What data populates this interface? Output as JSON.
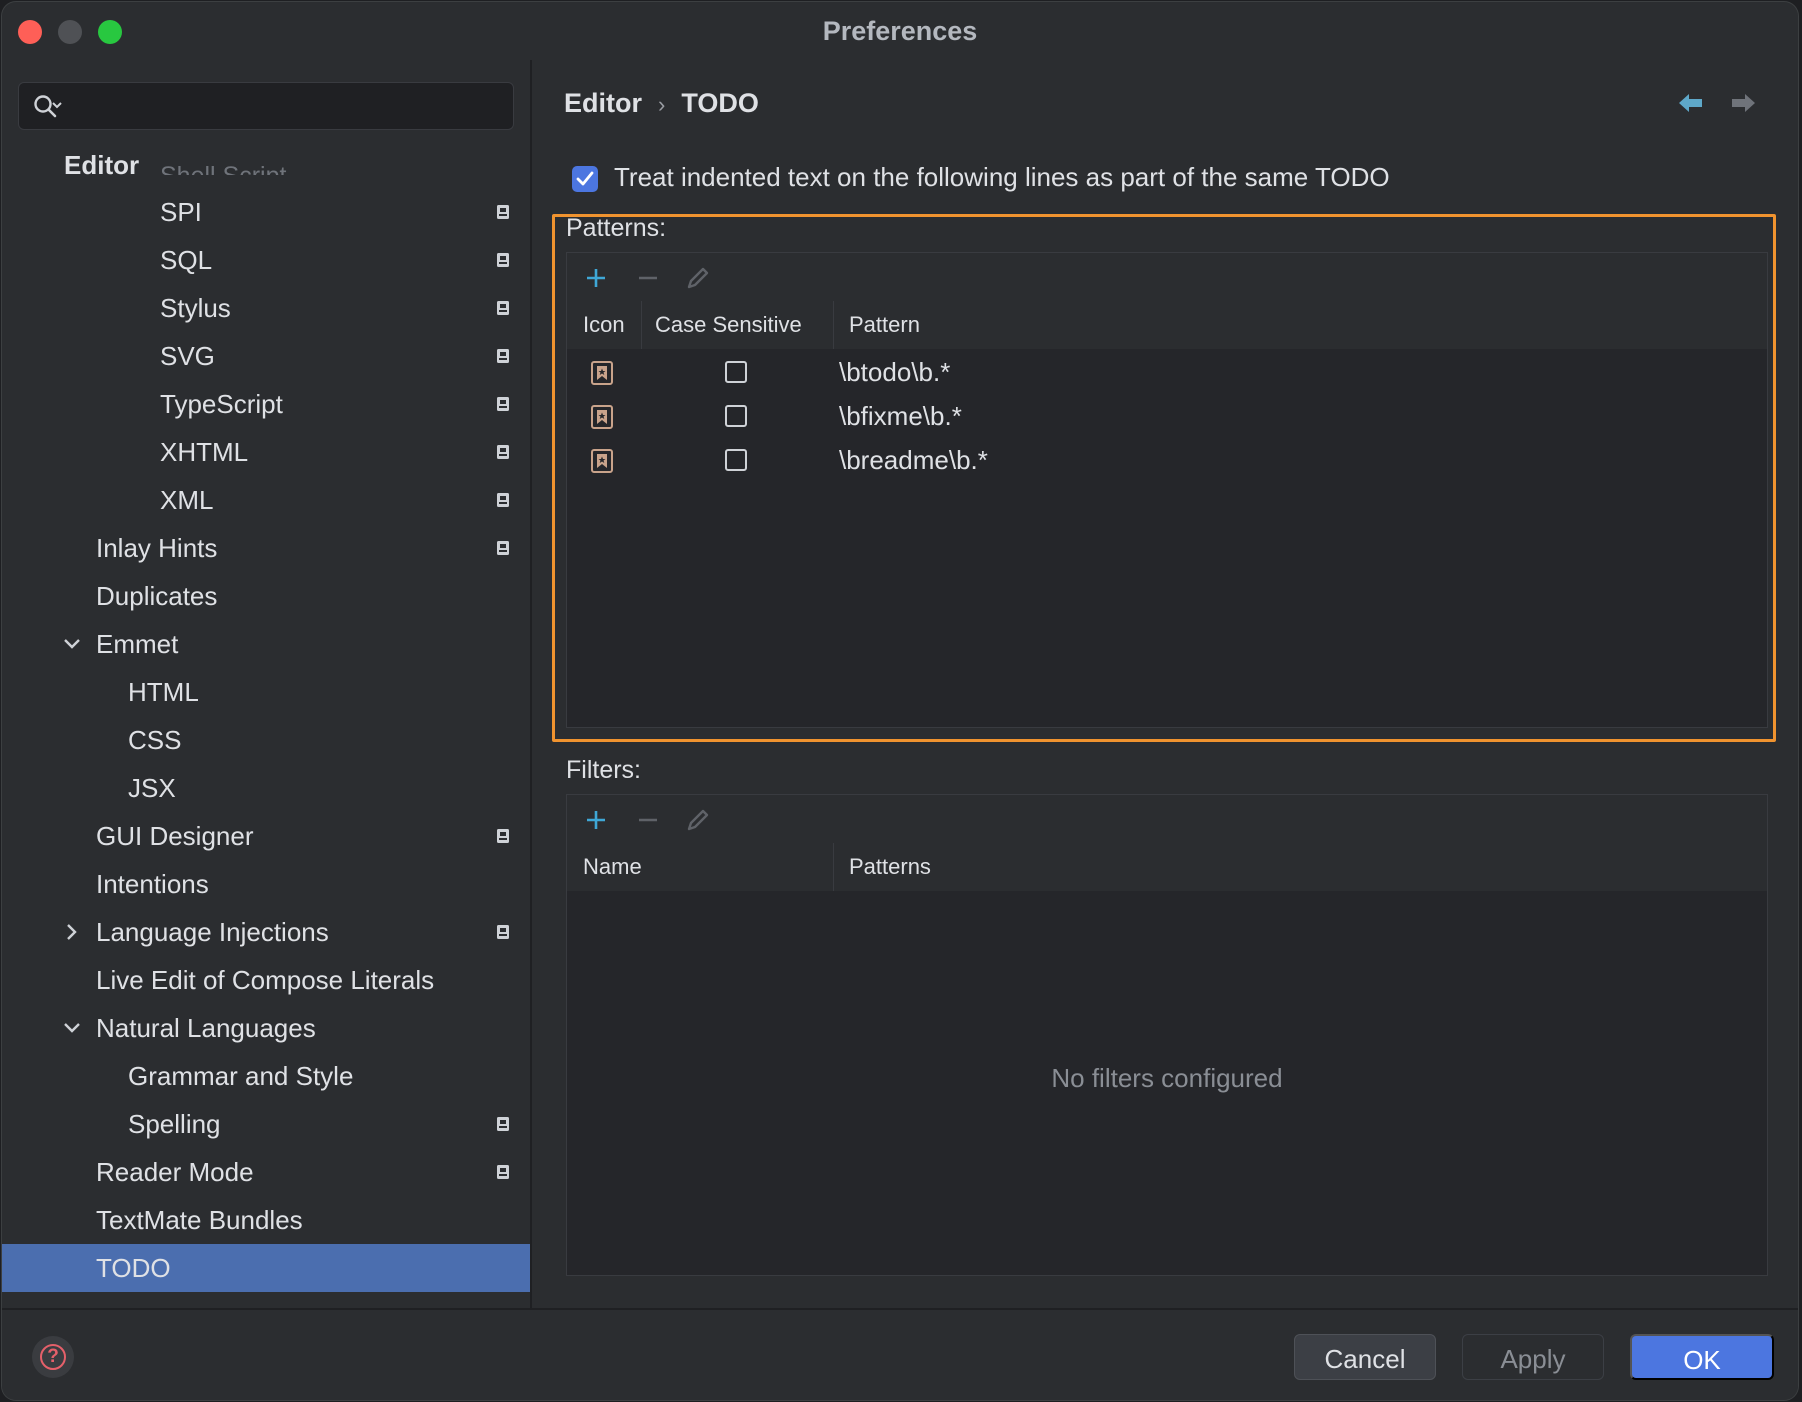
{
  "window": {
    "title": "Preferences"
  },
  "sidebar": {
    "search": {
      "value": "",
      "placeholder": ""
    },
    "sticky_header": "Editor",
    "ghost_item": "Shell Script",
    "items": [
      {
        "label": "SPI",
        "level": 2,
        "project": true,
        "expander": ""
      },
      {
        "label": "SQL",
        "level": 2,
        "project": true,
        "expander": ""
      },
      {
        "label": "Stylus",
        "level": 2,
        "project": true,
        "expander": ""
      },
      {
        "label": "SVG",
        "level": 2,
        "project": true,
        "expander": ""
      },
      {
        "label": "TypeScript",
        "level": 2,
        "project": true,
        "expander": ""
      },
      {
        "label": "XHTML",
        "level": 2,
        "project": true,
        "expander": ""
      },
      {
        "label": "XML",
        "level": 2,
        "project": true,
        "expander": ""
      },
      {
        "label": "Inlay Hints",
        "level": 0,
        "project": true,
        "expander": ""
      },
      {
        "label": "Duplicates",
        "level": 0,
        "project": false,
        "expander": ""
      },
      {
        "label": "Emmet",
        "level": 0,
        "project": false,
        "expander": "expanded"
      },
      {
        "label": "HTML",
        "level": 1,
        "project": false,
        "expander": ""
      },
      {
        "label": "CSS",
        "level": 1,
        "project": false,
        "expander": ""
      },
      {
        "label": "JSX",
        "level": 1,
        "project": false,
        "expander": ""
      },
      {
        "label": "GUI Designer",
        "level": 0,
        "project": true,
        "expander": ""
      },
      {
        "label": "Intentions",
        "level": 0,
        "project": false,
        "expander": ""
      },
      {
        "label": "Language Injections",
        "level": 0,
        "project": true,
        "expander": "collapsed"
      },
      {
        "label": "Live Edit of Compose Literals",
        "level": 0,
        "project": false,
        "expander": ""
      },
      {
        "label": "Natural Languages",
        "level": 0,
        "project": false,
        "expander": "expanded"
      },
      {
        "label": "Grammar and Style",
        "level": 1,
        "project": false,
        "expander": ""
      },
      {
        "label": "Spelling",
        "level": 1,
        "project": true,
        "expander": ""
      },
      {
        "label": "Reader Mode",
        "level": 0,
        "project": true,
        "expander": ""
      },
      {
        "label": "TextMate Bundles",
        "level": 0,
        "project": false,
        "expander": ""
      },
      {
        "label": "TODO",
        "level": 0,
        "project": false,
        "expander": "",
        "selected": true
      }
    ]
  },
  "main": {
    "breadcrumb": {
      "parent": "Editor",
      "separator": "›",
      "current": "TODO"
    },
    "option": {
      "label": "Treat indented text on the following lines as part of the same TODO",
      "checked": true
    },
    "patterns": {
      "label": "Patterns:",
      "columns": [
        "Icon",
        "Case Sensitive",
        "Pattern"
      ],
      "rows": [
        {
          "icon": "todo-bookmark-icon",
          "case_sensitive": false,
          "pattern": "\\btodo\\b.*"
        },
        {
          "icon": "todo-bookmark-icon",
          "case_sensitive": false,
          "pattern": "\\bfixme\\b.*"
        },
        {
          "icon": "todo-bookmark-icon",
          "case_sensitive": false,
          "pattern": "\\breadme\\b.*"
        }
      ]
    },
    "filters": {
      "label": "Filters:",
      "columns": [
        "Name",
        "Patterns"
      ],
      "empty_text": "No filters configured"
    }
  },
  "footer": {
    "cancel": "Cancel",
    "apply": "Apply",
    "ok": "OK"
  },
  "colors": {
    "accent": "#4c76e0",
    "selection": "#4b6eaf",
    "highlight_border": "#f0932f",
    "add_icon": "#3fa7d6"
  }
}
